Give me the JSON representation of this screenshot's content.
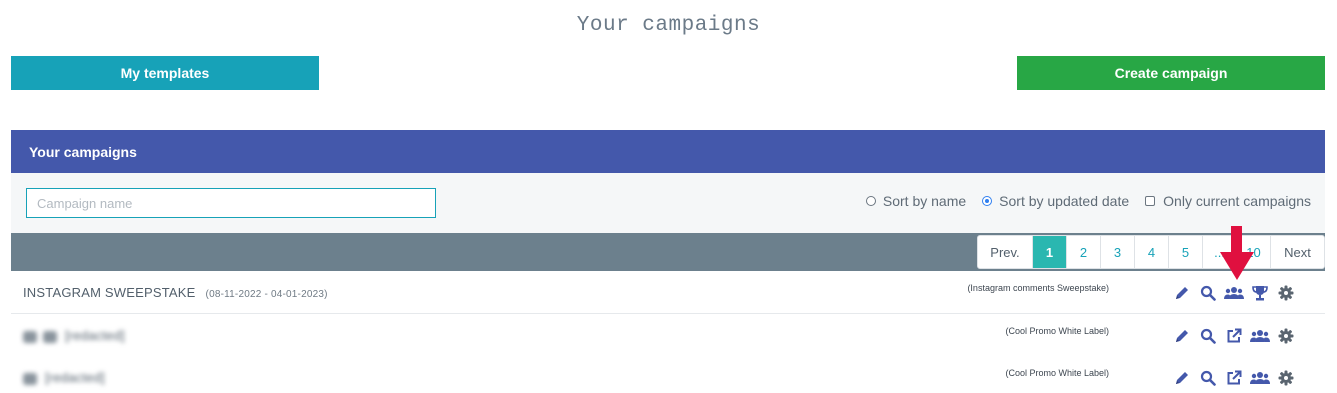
{
  "page": {
    "title": "Your campaigns"
  },
  "buttons": {
    "templates_label": "My templates",
    "create_label": "Create campaign"
  },
  "panel": {
    "header": "Your campaigns"
  },
  "filters": {
    "search_placeholder": "Campaign name",
    "sort_name_label": "Sort by name",
    "sort_date_label": "Sort by updated date",
    "only_current_label": "Only current campaigns",
    "selected_sort": "Sort by updated date",
    "only_current_checked": false
  },
  "pagination": {
    "prev_label": "Prev.",
    "pages": [
      "1",
      "2",
      "3",
      "4",
      "5",
      "...",
      "10"
    ],
    "active_page": "1",
    "next_label": "Next"
  },
  "campaigns": [
    {
      "title": "INSTAGRAM SWEEPSTAKE",
      "dates": "(08-11-2022 - 04-01-2023)",
      "type": "(Instagram comments Sweepstake)",
      "actions": [
        "pencil-icon",
        "search-icon",
        "users-icon",
        "trophy-icon",
        "gear-icon"
      ]
    },
    {
      "title": "[redacted]",
      "dates": "",
      "type": "(Cool Promo White Label)",
      "actions": [
        "pencil-icon",
        "search-icon",
        "external-link-icon",
        "users-icon",
        "gear-icon"
      ]
    },
    {
      "title": "[redacted]",
      "dates": "",
      "type": "(Cool Promo White Label)",
      "actions": [
        "pencil-icon",
        "search-icon",
        "external-link-icon",
        "users-icon",
        "gear-icon"
      ]
    }
  ],
  "colors": {
    "header_bg": "#4458ab",
    "templates_btn": "#17a2b8",
    "create_btn": "#28a745",
    "pager_bar": "#6c808d",
    "active_page": "#2ab7b0",
    "icon": "#4458ab",
    "arrow": "#e0103f"
  }
}
